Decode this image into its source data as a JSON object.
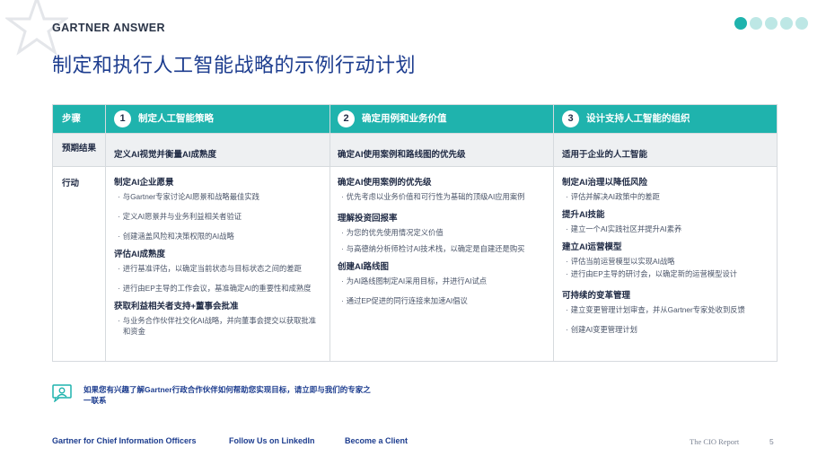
{
  "header": {
    "brand": "GARTNER ANSWER",
    "page_dots": 5,
    "active_dot": 0
  },
  "title": "制定和执行人工智能战略的示例行动计划",
  "table": {
    "row_labels": {
      "steps": "步骤",
      "outcomes": "预期结果",
      "actions": "行动"
    },
    "columns": [
      {
        "number": "1",
        "step": "制定人工智能策略",
        "outcome": "定义AI视觉并衡量AI成熟度",
        "sections": [
          {
            "title": "制定AI企业愿景",
            "items": [
              "与Gartner专家讨论AI愿景和战略最佳实践",
              "定义AI愿景并与业务利益相关者验证",
              "创建涵盖风险和决策权限的AI战略"
            ]
          },
          {
            "title": "评估AI成熟度",
            "items": [
              "进行基准评估，以确定当前状态与目标状态之间的差距",
              "进行由EP主导的工作会议，基准确定AI的重要性和成熟度"
            ]
          },
          {
            "title": "获取利益相关者支持+董事会批准",
            "items": [
              "与业务合作伙伴社交化AI战略，并向董事会提交以获取批准和资金"
            ]
          }
        ]
      },
      {
        "number": "2",
        "step": "确定用例和业务价值",
        "outcome": "确定AI使用案例和路线图的优先级",
        "sections": [
          {
            "title": "确定AI使用案例的优先级",
            "items": [
              "优先考虑以业务价值和可行性为基础的顶级AI应用案例"
            ]
          },
          {
            "title": "理解投资回报率",
            "items": [
              "为您的优先使用情况定义价值",
              "与高德纳分析师检讨AI技术栈，以确定是自建还是购买"
            ]
          },
          {
            "title": "创建AI路线图",
            "items": [
              "为AI路线图制定AI采用目标，并进行AI试点",
              "通过EP促进的同行连接来加速AI倡议"
            ]
          }
        ]
      },
      {
        "number": "3",
        "step": "设计支持人工智能的组织",
        "outcome": "适用于企业的人工智能",
        "sections": [
          {
            "title": "制定AI治理以降低风险",
            "items": [
              "评估并解决AI政策中的差距"
            ]
          },
          {
            "title": "提升AI技能",
            "items": [
              "建立一个AI实践社区并提升AI素养"
            ]
          },
          {
            "title": "建立AI运营模型",
            "items": [
              "评估当前运营模型以实现AI战略",
              "进行由EP主导的研讨会，以确定新的运营模型设计"
            ]
          },
          {
            "title": "可持续的变革管理",
            "items": [
              "建立变更管理计划审查，并从Gartner专家处收到反馈",
              "创建AI变更管理计划"
            ]
          }
        ]
      }
    ]
  },
  "cta": "如果您有兴趣了解Gartner行政合作伙伴如何帮助您实现目标，请立即与我们的专家之一联系",
  "footer": {
    "link1": "Gartner for Chief Information Officers",
    "link2": "Follow Us on LinkedIn",
    "link3": "Become a Client",
    "report": "The CIO Report",
    "page": "5"
  },
  "colors": {
    "teal": "#1fb3ad",
    "navy": "#1d3d8f",
    "light_teal": "#bde7e5"
  }
}
